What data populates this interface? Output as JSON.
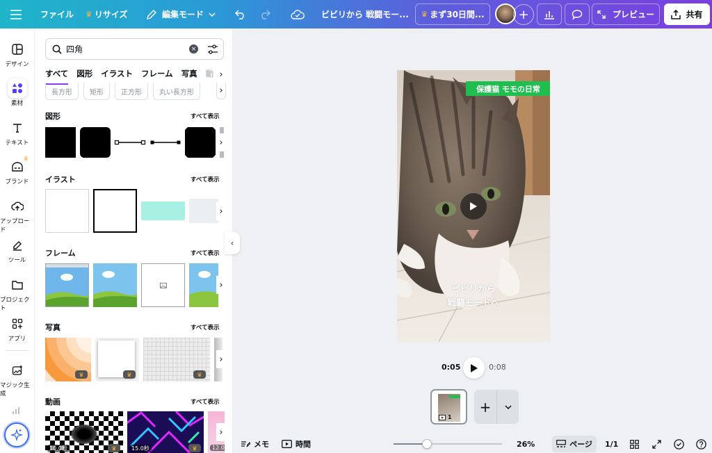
{
  "topbar": {
    "menu_icon": "hamburger-icon",
    "file": "ファイル",
    "resize": "リサイズ",
    "edit_mode": "編集モード",
    "doc_title": "ビビリから 戦闘モー...",
    "trial": "まず30日間...",
    "preview": "プレビュー",
    "share": "共有"
  },
  "rail": {
    "items": [
      {
        "label": "デザイン",
        "icon": "layout-icon"
      },
      {
        "label": "素材",
        "icon": "elements-icon"
      },
      {
        "label": "テキスト",
        "icon": "text-icon"
      },
      {
        "label": "ブランド",
        "icon": "brand-icon"
      },
      {
        "label": "アップロード",
        "icon": "upload-cloud-icon"
      },
      {
        "label": "ツール",
        "icon": "pen-tool-icon"
      },
      {
        "label": "プロジェクト",
        "icon": "folder-icon"
      },
      {
        "label": "アプリ",
        "icon": "apps-icon"
      },
      {
        "label": "マジック生成",
        "icon": "magic-image-icon"
      }
    ]
  },
  "panel": {
    "search_value": "四角",
    "tabs": [
      "すべて",
      "図形",
      "イラスト",
      "フレーム",
      "写真",
      "動"
    ],
    "chips": [
      "長方形",
      "矩形",
      "正方形",
      "丸い長方形"
    ],
    "sections": {
      "shapes": {
        "title": "図形",
        "more": "すべて表示"
      },
      "illust": {
        "title": "イラスト",
        "more": "すべて表示"
      },
      "frames": {
        "title": "フレーム",
        "more": "すべて表示"
      },
      "photos": {
        "title": "写真",
        "more": "すべて表示"
      },
      "videos": {
        "title": "動画",
        "more": "すべて表示"
      }
    },
    "video_durations": [
      "10.0秒",
      "15.0秒",
      "12.0"
    ]
  },
  "canvas": {
    "banner": "保護猫 モモの日常",
    "caption_line1": "ビビリから",
    "caption_line2": "戦闘モードへ",
    "time_current": "0:05",
    "time_total": "0:08",
    "page_number": "1"
  },
  "bottom": {
    "notes": "メモ",
    "time": "時間",
    "zoom": "26%",
    "zoom_fraction": 0.26,
    "pages": "ページ",
    "page_count": "1/1"
  },
  "colors": {
    "accent": "#8b3dff",
    "banner_green": "#1fbf4f",
    "crown": "#f6b73c"
  }
}
